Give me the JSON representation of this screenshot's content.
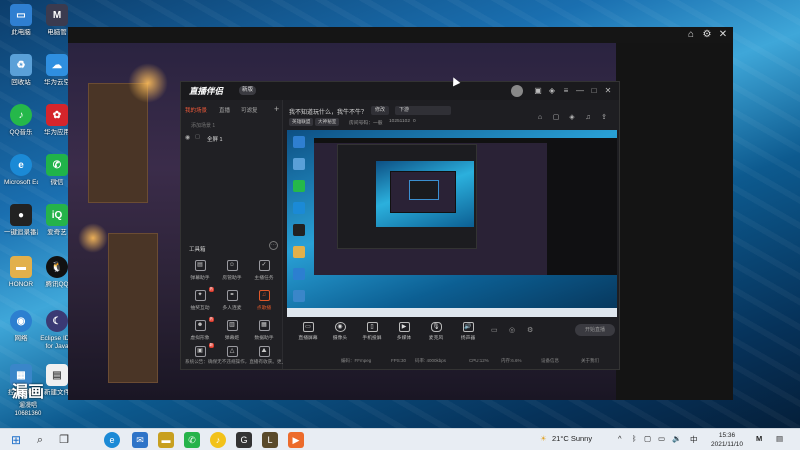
{
  "desktop": {
    "icons": [
      {
        "label": "此电脑",
        "icon": "computer-icon",
        "color": "#2f7fd1"
      },
      {
        "label": "电脑管",
        "icon": "pc-manager-icon",
        "color": "#3b3b4f"
      },
      {
        "label": "回收站",
        "icon": "recycle-bin-icon",
        "color": "#5aa0d8"
      },
      {
        "label": "华为云空",
        "icon": "cloud-icon",
        "color": "#2f8fe0"
      },
      {
        "label": "QQ音乐",
        "icon": "qq-music-icon",
        "color": "#25b84a"
      },
      {
        "label": "华为应用",
        "icon": "huawei-icon",
        "color": "#d5252b"
      },
      {
        "label": "Microsoft Edge",
        "icon": "edge-icon",
        "color": "#1b8ad6"
      },
      {
        "label": "微信",
        "icon": "wechat-icon",
        "color": "#20b34a"
      },
      {
        "label": "一键追录番片 时时",
        "icon": "recorder-icon",
        "color": "#222"
      },
      {
        "label": "爱奇艺",
        "icon": "iqiyi-icon",
        "color": "#25b34a"
      },
      {
        "label": "HONOR",
        "icon": "folder-icon",
        "color": "#e2b04b"
      },
      {
        "label": "腾讯QQ",
        "icon": "qq-icon",
        "color": "#111"
      },
      {
        "label": "网络",
        "icon": "network-icon",
        "color": "#2c7fd0"
      },
      {
        "label": "Eclipse IDE for Java",
        "icon": "eclipse-icon",
        "color": "#3b3a74"
      },
      {
        "label": "控制面板",
        "icon": "control-panel-icon",
        "color": "#3a86c9"
      },
      {
        "label": "新建文件",
        "icon": "new-file-icon",
        "color": "#f0f0f0"
      }
    ]
  },
  "watermark": {
    "big": "漏画",
    "small": "遛漫唱",
    "sub": "10681360"
  },
  "app": {
    "logo": "直播伴侣",
    "version": "新版",
    "tabs": [
      "我的场景",
      "直播",
      "可滤复"
    ],
    "add_scene_hint": "添加场景 1",
    "scene_name": "全屏 1",
    "tools_title": "工具箱",
    "tools": [
      {
        "label": "弹幕助手",
        "icon": "danmaku-icon"
      },
      {
        "label": "房管助手",
        "icon": "room-manager-icon"
      },
      {
        "label": "主播任务",
        "icon": "task-icon"
      },
      {
        "label": "抽奖互动",
        "icon": "lottery-icon",
        "badge": "热"
      },
      {
        "label": "多人连麦",
        "icon": "multi-link-icon"
      },
      {
        "label": "点歌播",
        "icon": "song-request-icon"
      },
      {
        "label": "虚拟形象",
        "icon": "avatar-icon",
        "badge": "热"
      },
      {
        "label": "弹幕姬",
        "icon": "danmaku-ji-icon"
      },
      {
        "label": "数据助手",
        "icon": "data-helper-icon"
      },
      {
        "label": "",
        "icon": "more-tool-icon",
        "badge": "新"
      },
      {
        "label": "",
        "icon": "triangle-tool-icon"
      },
      {
        "label": "",
        "icon": "mountain-tool-icon"
      }
    ],
    "notice": "系统公告：确保无不违规操作，直播有收获。更上一层楼",
    "header": {
      "title": "我不知道玩什么，我牛不牛？",
      "edit_pill": "修改",
      "category_pill": "下游",
      "tag1": "英雄联盟",
      "tag2": "大神秘室",
      "room_label": "房间号码：一般",
      "room_number": "10251102",
      "heat": "0"
    },
    "controls": [
      {
        "label": "直播屏幕",
        "icon": "screen-icon"
      },
      {
        "label": "摄像头",
        "icon": "camera-icon"
      },
      {
        "label": "手机投屏",
        "icon": "phone-cast-icon"
      },
      {
        "label": "多媒体",
        "icon": "media-icon"
      },
      {
        "label": "麦克风",
        "icon": "microphone-icon"
      },
      {
        "label": "扬声器",
        "icon": "speaker-icon"
      }
    ],
    "live_button": "开始直播",
    "status": [
      "编码：FFmpeg",
      "FPS:30",
      "码率: 4000kbps",
      "CPU:12%",
      "内存:6.6%",
      "设备信息",
      "关于我们"
    ]
  },
  "taskbar": {
    "apps": [
      {
        "icon": "start-icon",
        "color": "#1e6fc9"
      },
      {
        "icon": "search-icon",
        "color": "#444"
      },
      {
        "icon": "task-view-icon",
        "color": "#444"
      },
      {
        "icon": "edge-icon",
        "color": "#1b8ad6"
      },
      {
        "icon": "mail-icon",
        "color": "#2e74c8"
      },
      {
        "icon": "wechat-icon",
        "color": "#25b34a"
      },
      {
        "icon": "qq-music-icon",
        "color": "#f2c21a"
      },
      {
        "icon": "explorer-icon",
        "color": "#3a3a3a"
      },
      {
        "icon": "game-icon",
        "color": "#333"
      },
      {
        "icon": "kugou-icon",
        "color": "#ec6b2b"
      }
    ],
    "weather": "21°C  Sunny",
    "time": "15:36",
    "date": "2021/11/10"
  }
}
